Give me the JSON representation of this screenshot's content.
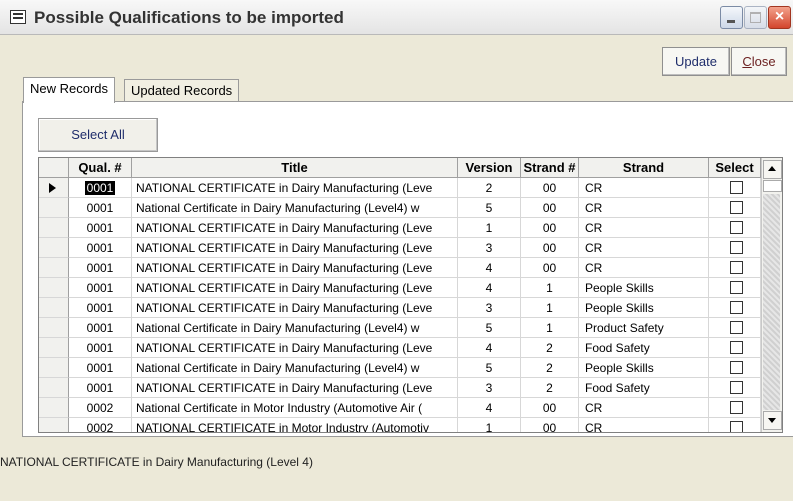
{
  "window": {
    "title": "Possible Qualifications to be imported"
  },
  "toolbar": {
    "update_label": "Update",
    "close_label_underlined": "C",
    "close_label_rest": "lose"
  },
  "tabs": [
    {
      "label": "New Records"
    },
    {
      "label": "Updated Records"
    }
  ],
  "select_all_label": "Select All",
  "grid": {
    "headers": {
      "qual": "Qual. #",
      "title": "Title",
      "version": "Version",
      "strand_num": "Strand #",
      "strand": "Strand",
      "select": "Select"
    },
    "rows": [
      {
        "qual": "0001",
        "title": "NATIONAL CERTIFICATE in Dairy Manufacturing (Leve",
        "version": "2",
        "strand_num": "00",
        "strand": "CR",
        "checked": false
      },
      {
        "qual": "0001",
        "title": "National Certificate in Dairy Manufacturing (Level4) w",
        "version": "5",
        "strand_num": "00",
        "strand": "CR",
        "checked": false
      },
      {
        "qual": "0001",
        "title": "NATIONAL CERTIFICATE in Dairy Manufacturing (Leve",
        "version": "1",
        "strand_num": "00",
        "strand": "CR",
        "checked": false
      },
      {
        "qual": "0001",
        "title": "NATIONAL CERTIFICATE in Dairy Manufacturing (Leve",
        "version": "3",
        "strand_num": "00",
        "strand": "CR",
        "checked": false
      },
      {
        "qual": "0001",
        "title": "NATIONAL CERTIFICATE in Dairy Manufacturing (Leve",
        "version": "4",
        "strand_num": "00",
        "strand": "CR",
        "checked": false
      },
      {
        "qual": "0001",
        "title": "NATIONAL CERTIFICATE in Dairy Manufacturing (Leve",
        "version": "4",
        "strand_num": "1",
        "strand": "People Skills",
        "checked": false
      },
      {
        "qual": "0001",
        "title": "NATIONAL CERTIFICATE in Dairy Manufacturing (Leve",
        "version": "3",
        "strand_num": "1",
        "strand": "People Skills",
        "checked": false
      },
      {
        "qual": "0001",
        "title": "National Certificate in Dairy Manufacturing (Level4) w",
        "version": "5",
        "strand_num": "1",
        "strand": "Product Safety",
        "checked": false
      },
      {
        "qual": "0001",
        "title": "NATIONAL CERTIFICATE in Dairy Manufacturing (Leve",
        "version": "4",
        "strand_num": "2",
        "strand": "Food Safety",
        "checked": false
      },
      {
        "qual": "0001",
        "title": "National Certificate in Dairy Manufacturing (Level4) w",
        "version": "5",
        "strand_num": "2",
        "strand": "People Skills",
        "checked": false
      },
      {
        "qual": "0001",
        "title": "NATIONAL CERTIFICATE in Dairy Manufacturing (Leve",
        "version": "3",
        "strand_num": "2",
        "strand": "Food Safety",
        "checked": false
      },
      {
        "qual": "0002",
        "title": "National Certificate in Motor Industry (Automotive Air (",
        "version": "4",
        "strand_num": "00",
        "strand": "CR",
        "checked": false
      },
      {
        "qual": "0002",
        "title": "NATIONAL CERTIFICATE in Motor Industry (Automotiv",
        "version": "1",
        "strand_num": "00",
        "strand": "CR",
        "checked": false
      }
    ]
  },
  "status_text": "NATIONAL CERTIFICATE in Dairy Manufacturing (Level 4)"
}
